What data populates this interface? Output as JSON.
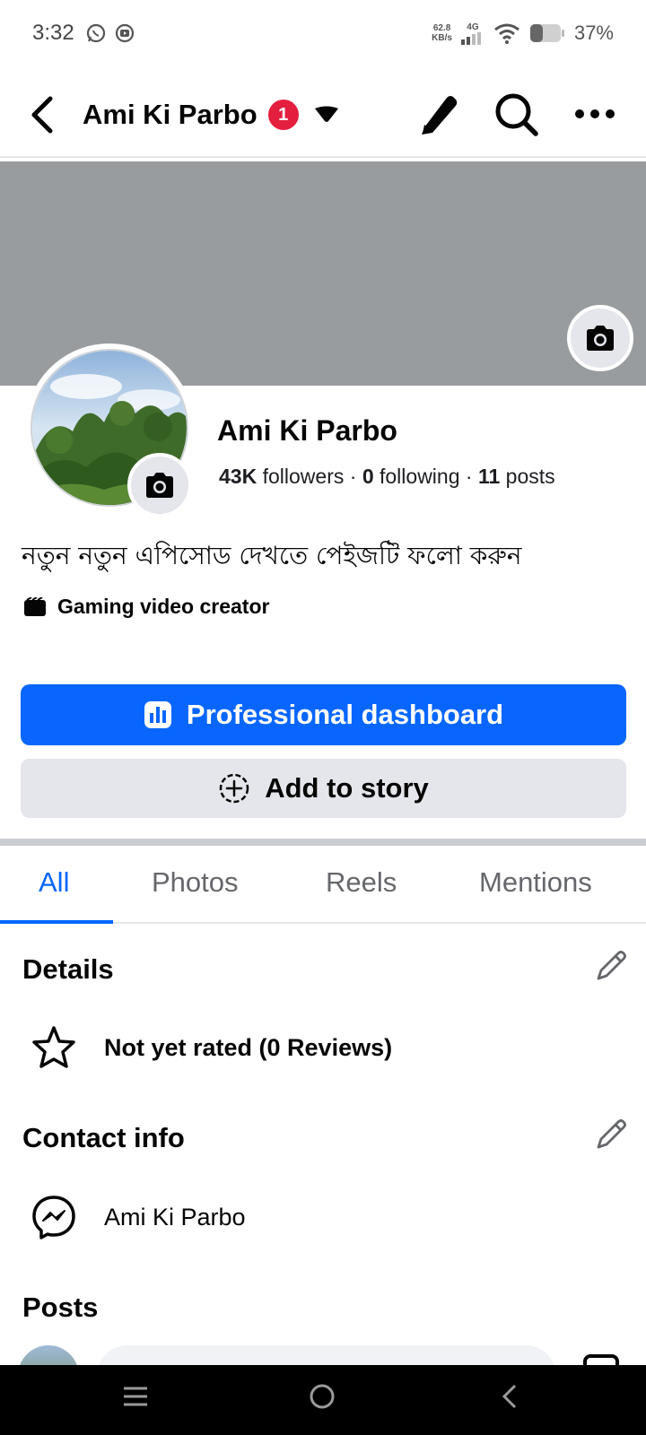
{
  "status_bar": {
    "time": "3:32",
    "net_speed_value": "62.8",
    "net_speed_unit": "KB/s",
    "network_type": "4G",
    "battery_percent": "37%"
  },
  "top_bar": {
    "page_name": "Ami Ki Parbo",
    "notification_count": "1"
  },
  "profile": {
    "name": "Ami Ki Parbo",
    "followers_count": "43K",
    "followers_label": "followers",
    "following_count": "0",
    "following_label": "following",
    "posts_count": "11",
    "posts_label": "posts",
    "separator": "·",
    "bio": "নতুন নতুন এপিসোড দেখতে পেইজটি ফলো করুন",
    "category": "Gaming video creator"
  },
  "actions": {
    "professional_dashboard": "Professional dashboard",
    "add_to_story": "Add to story"
  },
  "tabs": [
    "All",
    "Photos",
    "Reels",
    "Mentions"
  ],
  "active_tab": "All",
  "details": {
    "title": "Details",
    "rating_text": "Not yet rated (0 Reviews)"
  },
  "contact_info": {
    "title": "Contact info",
    "messenger_name": "Ami Ki Parbo"
  },
  "posts": {
    "title": "Posts"
  },
  "colors": {
    "accent_blue": "#0866ff",
    "badge_red": "#e41e3f",
    "cover_gray": "#999c9f",
    "button_gray": "#e4e6eb"
  }
}
